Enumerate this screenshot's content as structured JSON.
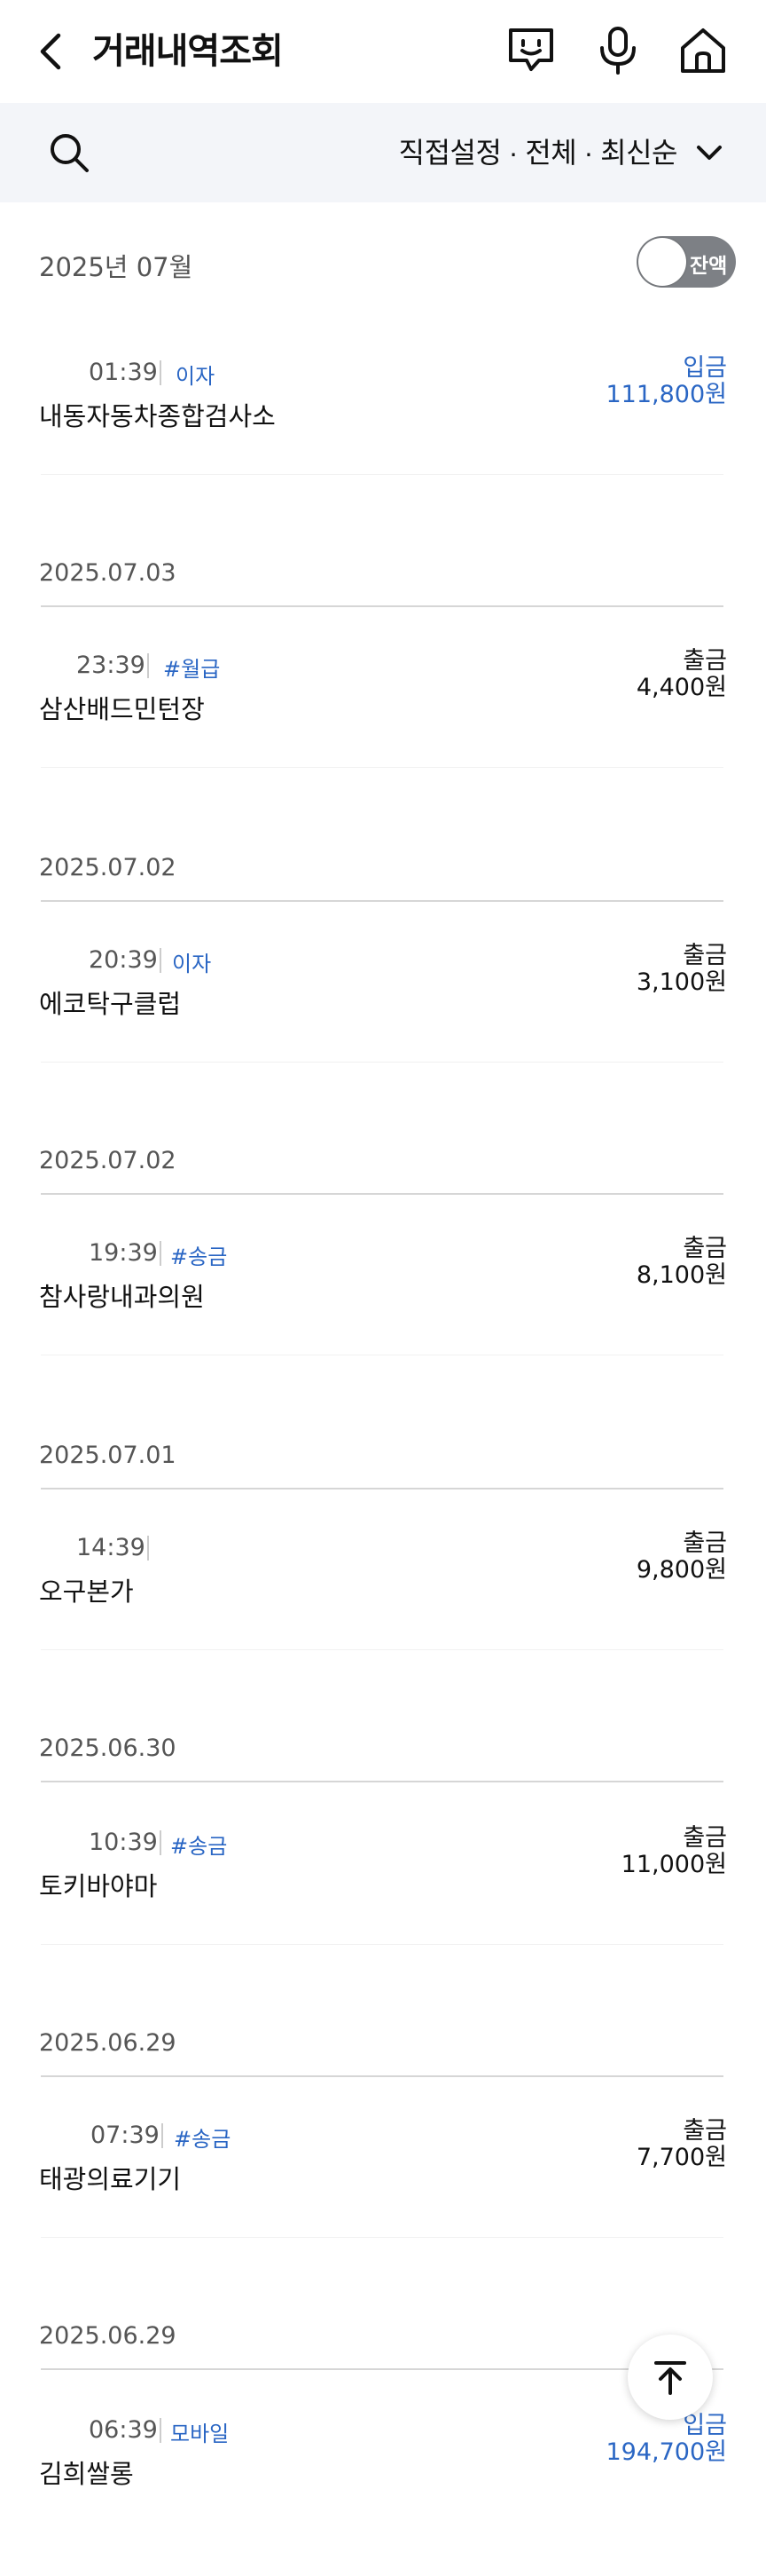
{
  "header": {
    "title": "거래내역조회"
  },
  "filter": {
    "label": "직접설정 · 전체 · 최신순"
  },
  "month": {
    "label": "2025년 07월",
    "balance_toggle_label": "잔액"
  },
  "colors": {
    "deposit": "#2a66c4",
    "withdrawal": "#111111",
    "filter_bg": "#f3f5f9",
    "toggle_bg": "#7d8085"
  },
  "icons": [
    "back-icon",
    "chat-icon",
    "mic-icon",
    "home-icon",
    "search-icon",
    "chevron-down-icon",
    "arrow-up-icon"
  ],
  "groups": [
    {
      "date": "",
      "transactions": [
        {
          "time": "01:39",
          "tag": "이자",
          "merchant": "내동자동차종합검사소",
          "type": "입금",
          "amount": "111,800원",
          "direction": "in"
        }
      ]
    },
    {
      "date": "2025.07.03",
      "transactions": [
        {
          "time": "23:39",
          "tag": "#월급",
          "merchant": "삼산배드민턴장",
          "type": "출금",
          "amount": "4,400원",
          "direction": "out"
        }
      ]
    },
    {
      "date": "2025.07.02",
      "transactions": [
        {
          "time": "20:39",
          "tag": "이자",
          "merchant": "에코탁구클럽",
          "type": "출금",
          "amount": "3,100원",
          "direction": "out"
        }
      ]
    },
    {
      "date": "2025.07.02",
      "transactions": [
        {
          "time": "19:39",
          "tag": "#송금",
          "merchant": "참사랑내과의원",
          "type": "출금",
          "amount": "8,100원",
          "direction": "out"
        }
      ]
    },
    {
      "date": "2025.07.01",
      "transactions": [
        {
          "time": "14:39",
          "tag": "",
          "merchant": "오구본가",
          "type": "출금",
          "amount": "9,800원",
          "direction": "out"
        }
      ]
    },
    {
      "date": "2025.06.30",
      "transactions": [
        {
          "time": "10:39",
          "tag": "#송금",
          "merchant": "토키바야마",
          "type": "출금",
          "amount": "11,000원",
          "direction": "out"
        }
      ]
    },
    {
      "date": "2025.06.29",
      "transactions": [
        {
          "time": "07:39",
          "tag": "#송금",
          "merchant": "태광의료기기",
          "type": "출금",
          "amount": "7,700원",
          "direction": "out"
        }
      ]
    },
    {
      "date": "2025.06.29",
      "transactions": [
        {
          "time": "06:39",
          "tag": "모바일",
          "merchant": "김희쌀롱",
          "type": "입금",
          "amount": "194,700원",
          "direction": "in"
        }
      ]
    }
  ]
}
